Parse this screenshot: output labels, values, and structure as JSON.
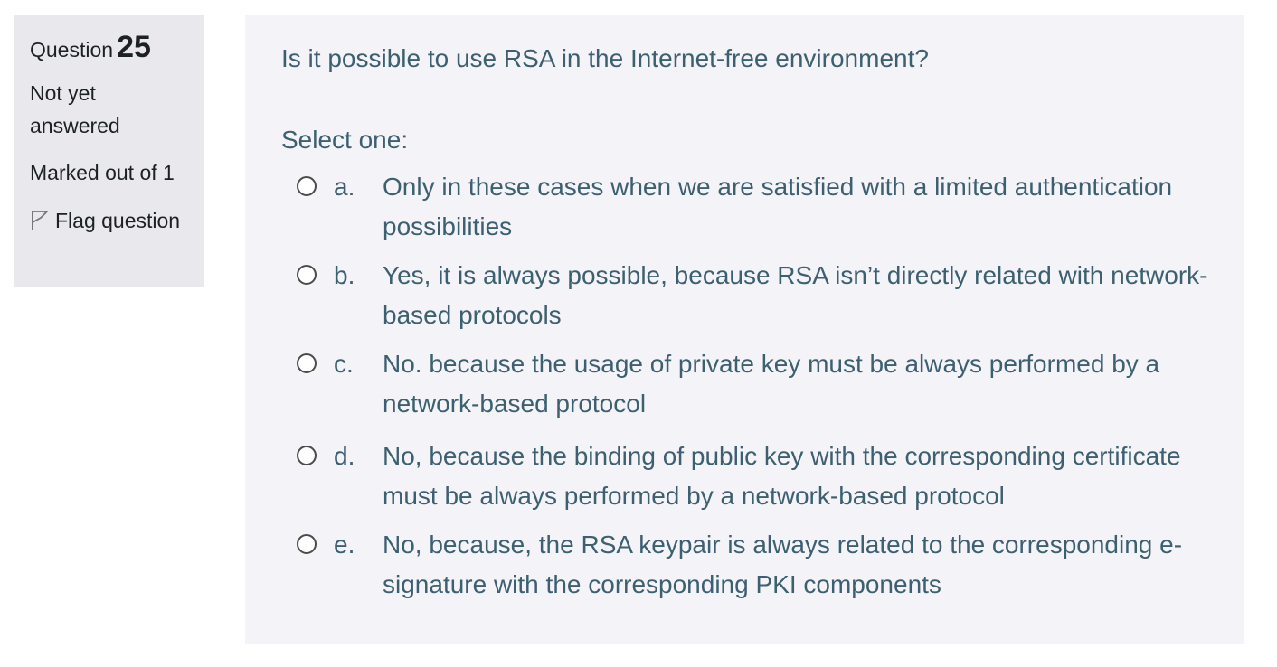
{
  "info": {
    "question_label": "Question",
    "question_number": "25",
    "state": "Not yet answered",
    "grade": "Marked out of 1",
    "flag_label": "Flag question",
    "flag_icon": "flag-outline-icon"
  },
  "question": {
    "text": "Is it possible to use RSA in the Internet-free environment?",
    "prompt": "Select one:",
    "answers": [
      {
        "letter": "a.",
        "text": "Only in these cases when we are satisfied with a limited authentication possibilities"
      },
      {
        "letter": "b.",
        "text": "Yes, it is always possible, because RSA isn’t directly related with network-based protocols"
      },
      {
        "letter": "c.",
        "text": "No. because the usage of private key must be always performed by a network-based protocol"
      },
      {
        "letter": "d.",
        "text": "No, because the binding of public key with the corresponding certificate must be always performed by a network-based protocol"
      },
      {
        "letter": "e.",
        "text": "No, because, the RSA keypair is always related to the corresponding e-signature with the corresponding PKI components"
      }
    ]
  },
  "colors": {
    "info_bg": "#e9e9ed",
    "content_bg": "#f3f3f8",
    "content_text": "#3d6070"
  }
}
